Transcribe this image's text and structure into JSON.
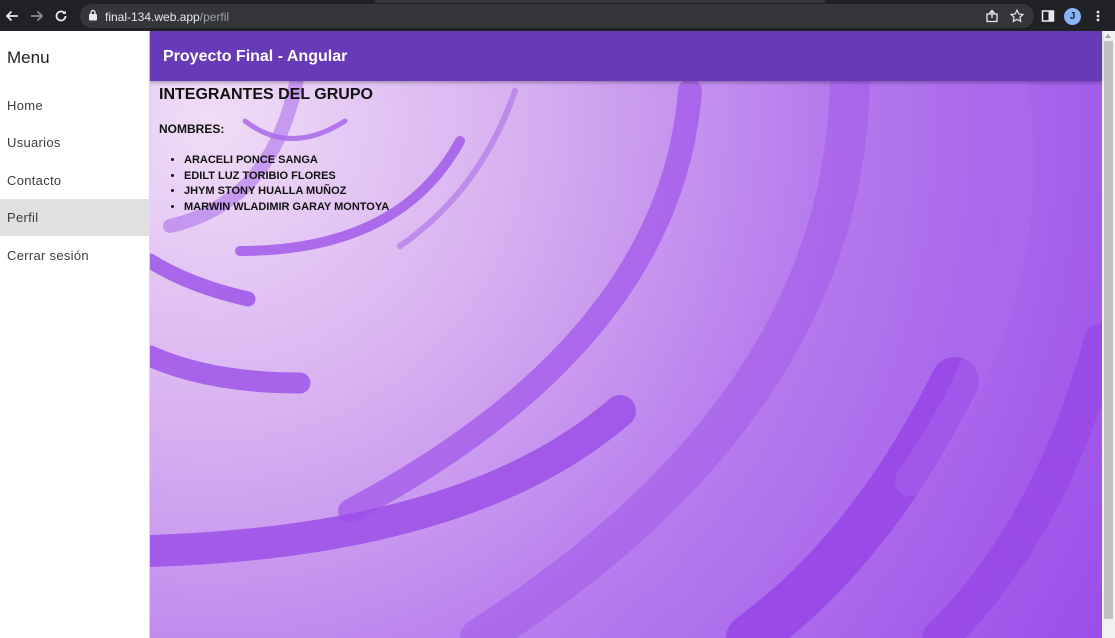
{
  "browser": {
    "url_host": "final-134.web.app",
    "url_path": "/perfil",
    "profile_initial": "J"
  },
  "sidebar": {
    "title": "Menu",
    "items": [
      {
        "label": "Home",
        "active": false
      },
      {
        "label": "Usuarios",
        "active": false
      },
      {
        "label": "Contacto",
        "active": false
      },
      {
        "label": "Perfil",
        "active": true
      },
      {
        "label": "Cerrar sesión",
        "active": false
      }
    ]
  },
  "toolbar": {
    "title": "Proyecto Final - Angular"
  },
  "content": {
    "heading": "INTEGRANTES DEL GRUPO",
    "subheading": "NOMBRES:",
    "names": [
      "ARACELI PONCE SANGA",
      "EDILT LUZ TORIBIO FLORES",
      "JHYM STONY HUALLA MUÑOZ",
      "MARWIN WLADIMIR GARAY MONTOYA"
    ]
  },
  "colors": {
    "toolbar": "#673ab7",
    "active_item": "#e0e0e0",
    "background_light": "#f0ddf7",
    "background_dark": "#9a4ee9"
  }
}
